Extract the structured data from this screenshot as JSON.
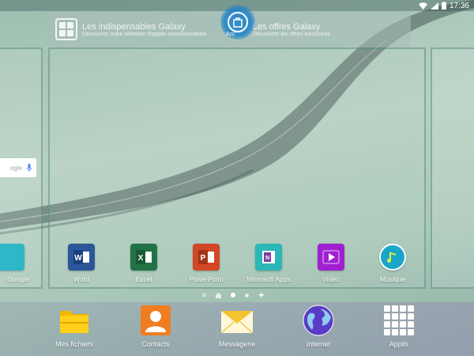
{
  "status_bar": {
    "time": "17:36"
  },
  "banner": {
    "items": [
      {
        "title": "Les indispensables Galaxy",
        "description": "Découvrez notre sélection d'applis incontournables"
      },
      {
        "title": "Les offres Galaxy",
        "description": "Découvrez les offres exclusives"
      }
    ],
    "home_label": "Acc"
  },
  "search_widget": {
    "text": "ogle"
  },
  "apps": [
    {
      "label": "Google",
      "icon": "google-folder-icon"
    },
    {
      "label": "Word",
      "icon": "word-icon",
      "color": "#2b579a"
    },
    {
      "label": "Excel",
      "icon": "excel-icon",
      "color": "#217346"
    },
    {
      "label": "PowerPoint",
      "icon": "powerpoint-icon",
      "color": "#d24726"
    },
    {
      "label": "Microsoft Apps",
      "icon": "microsoft-apps-icon",
      "color": "#2cb7b7"
    },
    {
      "label": "Vidéo",
      "icon": "video-icon",
      "color": "#a020d0"
    },
    {
      "label": "Musique",
      "icon": "music-icon",
      "color": "#1aa6c9"
    }
  ],
  "dock": [
    {
      "label": "Mes fichiers",
      "icon": "folder-icon",
      "color": "#f5b800"
    },
    {
      "label": "Contacts",
      "icon": "contacts-icon",
      "color": "#ef7d22"
    },
    {
      "label": "Messagerie",
      "icon": "mail-icon",
      "color": "#f4c430"
    },
    {
      "label": "Internet",
      "icon": "internet-icon",
      "color": "#5b3cc4"
    },
    {
      "label": "Applis",
      "icon": "apps-grid-icon",
      "color": "#ffffff"
    }
  ]
}
